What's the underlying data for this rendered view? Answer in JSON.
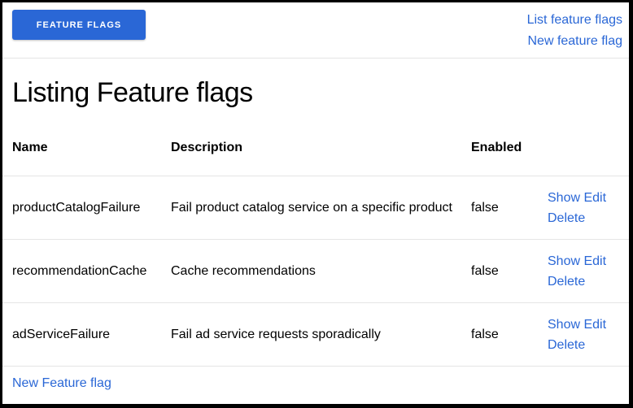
{
  "header": {
    "brand_label": "FEATURE FLAGS",
    "nav": {
      "list_link": "List feature flags",
      "new_link": "New feature flag"
    }
  },
  "page": {
    "title": "Listing Feature flags"
  },
  "table": {
    "columns": [
      "Name",
      "Description",
      "Enabled"
    ],
    "rows": [
      {
        "name": "productCatalogFailure",
        "description": "Fail product catalog service on a specific product",
        "enabled": "false"
      },
      {
        "name": "recommendationCache",
        "description": "Cache recommendations",
        "enabled": "false"
      },
      {
        "name": "adServiceFailure",
        "description": "Fail ad service requests sporadically",
        "enabled": "false"
      }
    ],
    "actions": {
      "show": "Show",
      "edit": "Edit",
      "delete": "Delete"
    }
  },
  "footer": {
    "new_link": "New Feature flag"
  },
  "colors": {
    "accent": "#2a67d6",
    "divider": "#e5e5e5"
  }
}
